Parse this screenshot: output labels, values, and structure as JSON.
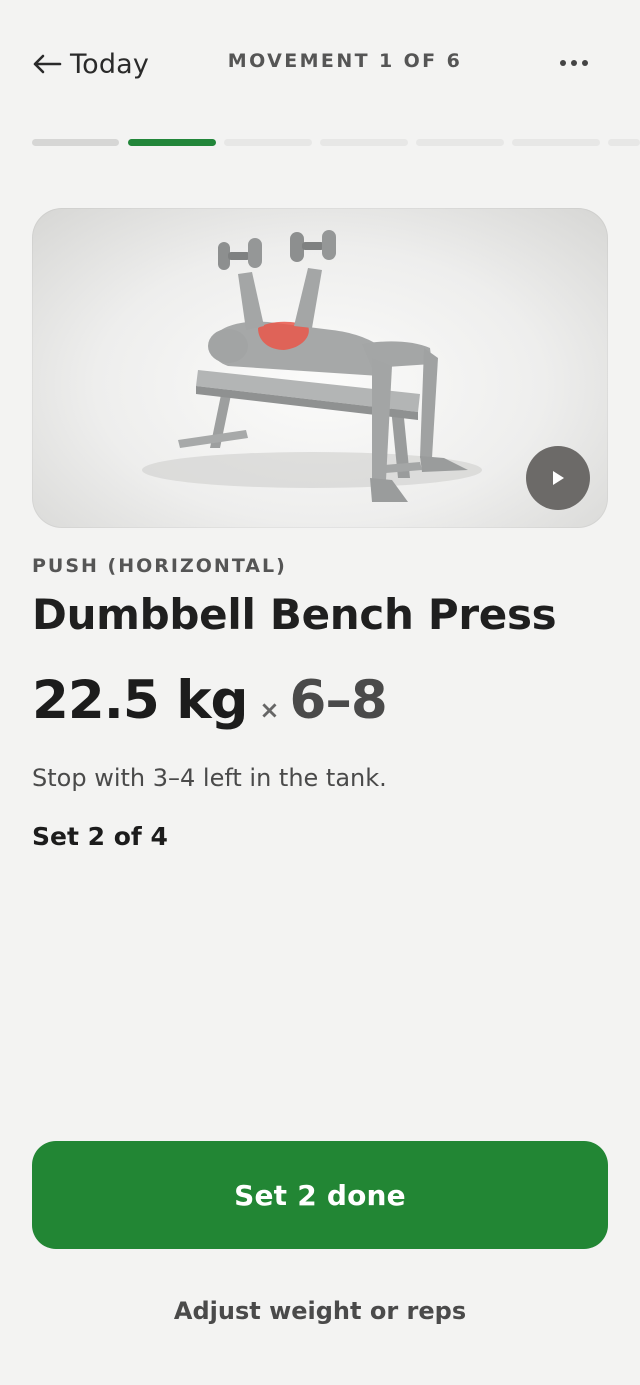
{
  "header": {
    "back_arrow": "←",
    "back_label": "Today",
    "movement_label": "MOVEMENT 1 OF 6",
    "more_icon": "more-horizontal-icon"
  },
  "progress": {
    "total_segments": 7,
    "active_segment": 2,
    "accent_color": "#22863a"
  },
  "media": {
    "play_icon": "play-icon",
    "highlight_color": "#e9574a"
  },
  "exercise": {
    "category": "PUSH (HORIZONTAL)",
    "name": "Dumbbell Bench Press",
    "weight": "22.5 kg",
    "times": "×",
    "reps": "6–8",
    "cue": "Stop with 3–4 left in the tank.",
    "set_status": "Set 2 of 4"
  },
  "actions": {
    "primary_label": "Set 2 done",
    "primary_color": "#228634",
    "secondary_label": "Adjust weight or reps"
  }
}
